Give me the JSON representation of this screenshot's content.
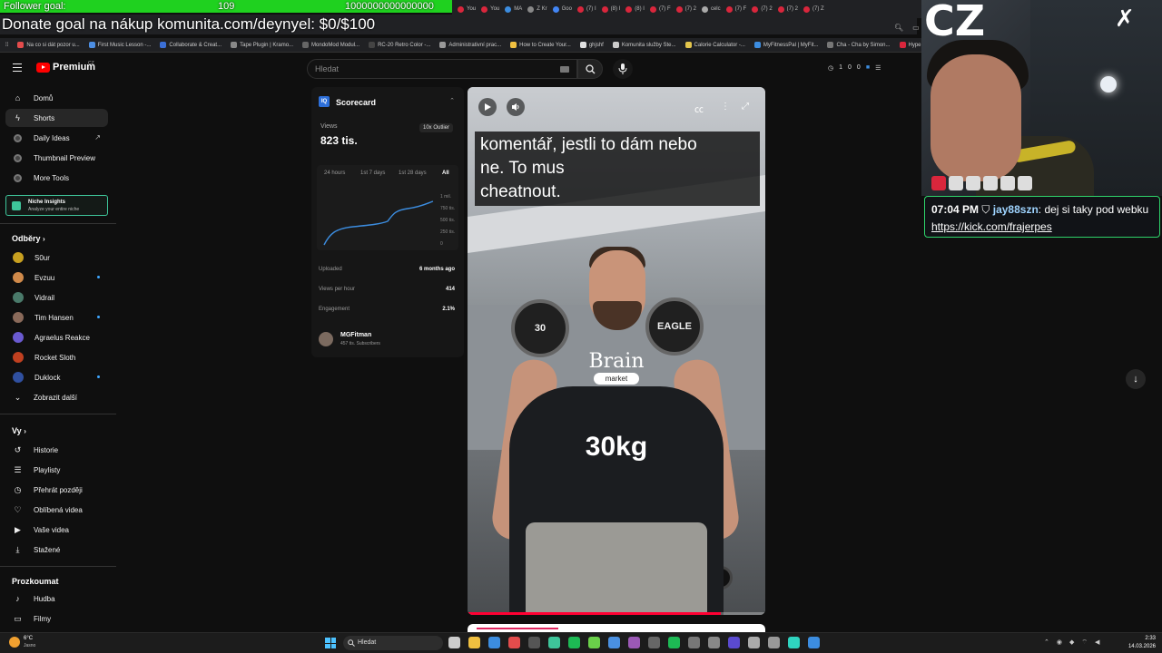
{
  "overlay": {
    "goal_label": "Follower goal:",
    "goal_count": "109",
    "goal_target": "1000000000000000",
    "donate_text": "Donate goal na nákup komunita.com/deynyel: $0/$100",
    "corner_text": "CZ"
  },
  "browser": {
    "tabs": [
      "You",
      "You",
      "MA",
      "Z Kr",
      "Goo",
      "(7) I",
      "(8) I",
      "(8) I",
      "(7) F",
      "(7) 2",
      "celc",
      "(7) F",
      "(7) 2",
      "(7) 2",
      "(7) Z"
    ],
    "bookmarks": [
      {
        "label": "Na co si dát pozor u...",
        "color": "#e34c4c"
      },
      {
        "label": "First Music Lesson -...",
        "color": "#4c8ee3"
      },
      {
        "label": "Collaborate & Creat...",
        "color": "#3b6fd6"
      },
      {
        "label": "Tape Plugin | Kramo...",
        "color": "#888888"
      },
      {
        "label": "MondoMod Modul...",
        "color": "#666666"
      },
      {
        "label": "RC-20 Retro Color -...",
        "color": "#444444"
      },
      {
        "label": "Administrativní prac...",
        "color": "#999999"
      },
      {
        "label": "How to Create Your...",
        "color": "#f0c040"
      },
      {
        "label": "ghjshf",
        "color": "#e0e0e0"
      },
      {
        "label": "Komunita služby Ste...",
        "color": "#cccccc"
      },
      {
        "label": "Calorie Calculator -...",
        "color": "#e3c54c"
      },
      {
        "label": "MyFitnessPal | MyFit...",
        "color": "#3c8de0"
      },
      {
        "label": "Cha - Cha by Simon...",
        "color": "#777777"
      },
      {
        "label": "Hype",
        "color": "#d9263c"
      }
    ]
  },
  "youtube": {
    "logo_text": "Premium",
    "logo_country": "CZ",
    "search_placeholder": "Hledat",
    "header_stats": [
      "1",
      "0",
      "0"
    ],
    "nav": [
      {
        "label": "Domů",
        "icon": "home-icon"
      },
      {
        "label": "Shorts",
        "icon": "shorts-icon",
        "active": true
      },
      {
        "label": "Daily Ideas",
        "icon": "ideas-icon"
      },
      {
        "label": "Thumbnail Preview",
        "icon": "thumbnail-icon"
      },
      {
        "label": "More Tools",
        "icon": "tools-icon"
      }
    ],
    "niche": {
      "title": "Niche Insights",
      "subtitle": "Analyze your entire niche"
    },
    "subs_title": "Odběry",
    "subscriptions": [
      {
        "label": "S0ur",
        "color": "#c8a020",
        "new": false
      },
      {
        "label": "Evzuu",
        "color": "#d08a4a",
        "new": true
      },
      {
        "label": "Vidrail",
        "color": "#4a7a6a",
        "new": false
      },
      {
        "label": "Tim Hansen",
        "color": "#8a6a5a",
        "new": true
      },
      {
        "label": "Agraelus Reakce",
        "color": "#6a5ad0",
        "new": false
      },
      {
        "label": "Rocket Sloth",
        "color": "#c04020",
        "new": false
      },
      {
        "label": "Duklock",
        "color": "#3050a0",
        "new": true
      }
    ],
    "show_more": "Zobrazit další",
    "you_title": "Vy",
    "you_items": [
      {
        "label": "Historie",
        "icon": "history-icon"
      },
      {
        "label": "Playlisty",
        "icon": "playlist-icon"
      },
      {
        "label": "Přehrát později",
        "icon": "watch-later-icon"
      },
      {
        "label": "Oblíbená videa",
        "icon": "liked-icon"
      },
      {
        "label": "Vaše videa",
        "icon": "your-videos-icon"
      },
      {
        "label": "Stažené",
        "icon": "download-icon"
      }
    ],
    "explore_title": "Prozkoumat",
    "explore_items": [
      {
        "label": "Hudba",
        "icon": "music-icon"
      },
      {
        "label": "Filmy",
        "icon": "movies-icon"
      }
    ]
  },
  "scorecard": {
    "badge": "IQ",
    "title": "Scorecard",
    "views_label": "Views",
    "views_value": "823 tis.",
    "outlier": "10x Outlier",
    "ranges": [
      "24 hours",
      "1st 7 days",
      "1st 28 days",
      "All"
    ],
    "selected_range": "All",
    "chart_y_ticks": [
      "1 mil.",
      "750 tis.",
      "500 tis.",
      "250 tis.",
      "0"
    ],
    "uploaded_label": "Uploaded",
    "uploaded_value": "6 months ago",
    "vph_label": "Views per hour",
    "vph_value": "414",
    "engagement_label": "Engagement",
    "engagement_value": "2.1%",
    "channel_name": "MGFitman",
    "channel_subs": "457 tis. Subscribers"
  },
  "video": {
    "caption_line1": "komentář, jestli to dám nebo",
    "caption_line2": "ne. To mus",
    "caption_line3": "cheatnout.",
    "shirt_brand": "Brain",
    "shirt_brand_sub": "market",
    "weight_text": "30kg",
    "dumbbell_left": "30",
    "dumbbell_right": "EAGLE",
    "progress": 0.85
  },
  "chat": {
    "time": "07:04 PM",
    "user": "jay88szn",
    "message_prefix": "dej si taky pod webku",
    "link": "https://kick.com/frajerpes"
  },
  "taskbar": {
    "temp": "6°C",
    "condition": "Jasno",
    "search": "Hledat",
    "app_colors": [
      "#cccccc",
      "#f0c040",
      "#3c8de0",
      "#e34c4c",
      "#555555",
      "#3ec59a",
      "#1db954",
      "#6ad04a",
      "#4a90e2",
      "#9b59b6",
      "#666666",
      "#1db954",
      "#777777",
      "#888888",
      "#5a4ad0",
      "#aaaaaa",
      "#999999",
      "#2fd4c0",
      "#3c8de0"
    ],
    "time": "2:33",
    "date": "14.03.2026"
  }
}
